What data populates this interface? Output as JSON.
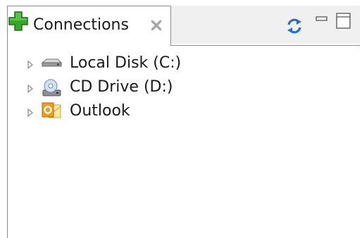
{
  "panel": {
    "tab": {
      "title": "Connections",
      "icon": "add-plus-icon",
      "close_icon": "close-icon"
    },
    "toolbar": {
      "refresh_icon": "refresh-icon",
      "minimize_icon": "minimize-icon",
      "maximize_icon": "maximize-icon"
    },
    "tree": {
      "items": [
        {
          "label": "Local Disk (C:)",
          "icon": "hard-disk-icon"
        },
        {
          "label": "CD Drive (D:)",
          "icon": "cd-drive-icon"
        },
        {
          "label": "Outlook",
          "icon": "outlook-icon"
        }
      ]
    }
  },
  "colors": {
    "plus_green": "#2e9e1f",
    "refresh_blue": "#1f6fd6",
    "border": "#8c8c8c",
    "tabbar_bg": "#f0f0f0"
  }
}
